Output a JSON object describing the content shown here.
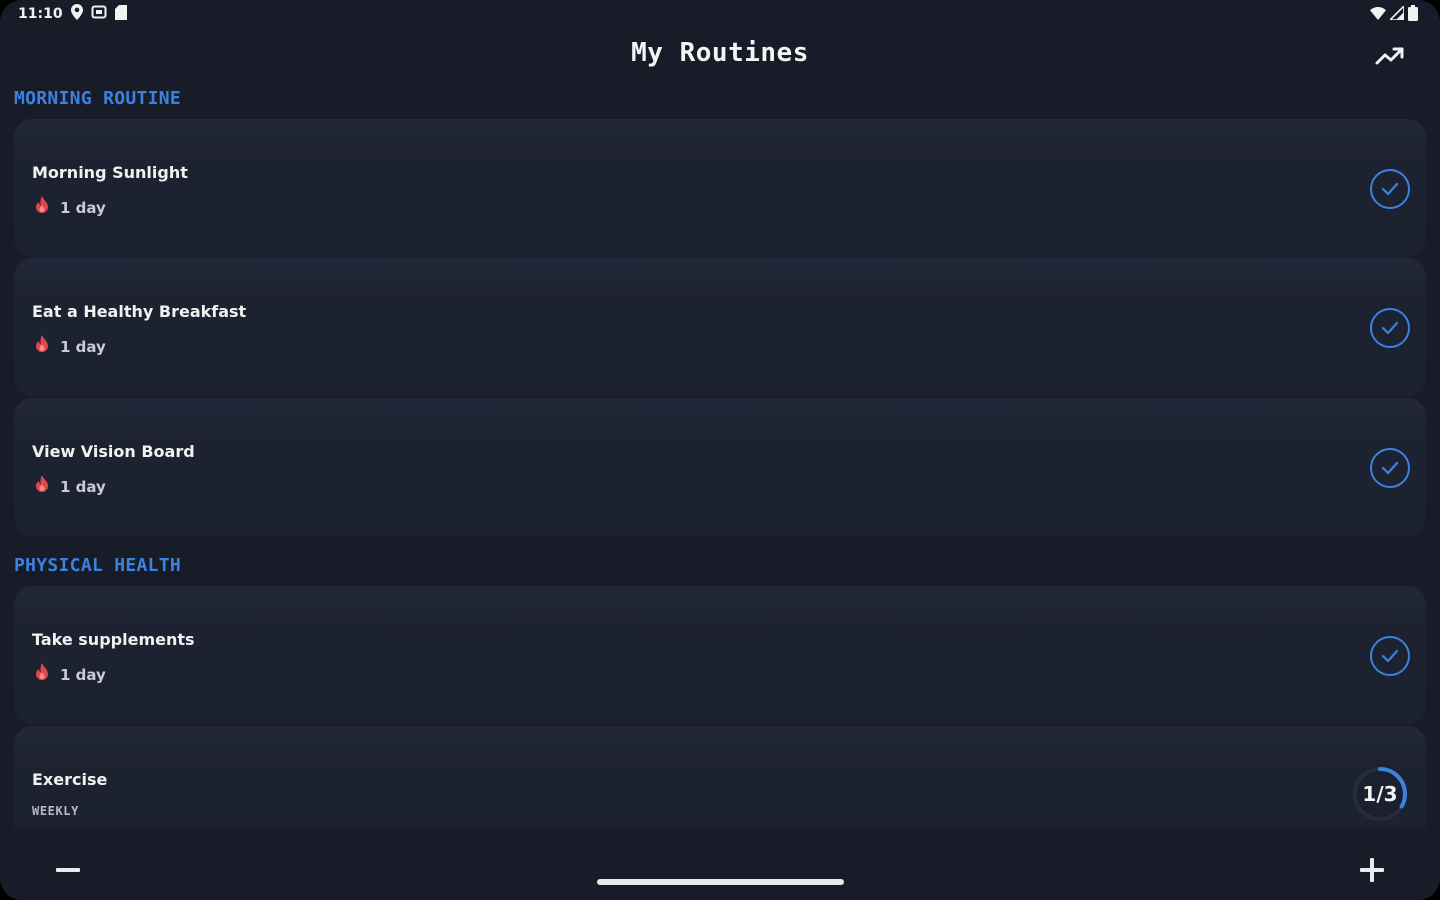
{
  "status_bar": {
    "time": "11:10",
    "left_icons": [
      "location-icon",
      "screen-cast-icon",
      "sd-card-icon"
    ],
    "right_icons": [
      "wifi-icon",
      "signal-icon",
      "battery-icon"
    ]
  },
  "header": {
    "title": "My Routines",
    "trend_icon": "trending-up-icon"
  },
  "sections": [
    {
      "label": "MORNING ROUTINE",
      "items": [
        {
          "name": "Morning Sunlight",
          "streak": "1 day",
          "status": "done"
        },
        {
          "name": "Eat a Healthy Breakfast",
          "streak": "1 day",
          "status": "done"
        },
        {
          "name": "View Vision Board",
          "streak": "1 day",
          "status": "done"
        }
      ]
    },
    {
      "label": "PHYSICAL HEALTH",
      "items": [
        {
          "name": "Take supplements",
          "streak": "1 day",
          "status": "done"
        },
        {
          "name": "Exercise",
          "frequency": "WEEKLY",
          "progress": "1/3",
          "progress_fraction": 0.333
        }
      ]
    }
  ],
  "bottom_bar": {
    "left_icon": "minus-icon",
    "right_icon": "plus-icon"
  },
  "colors": {
    "background": "#181c28",
    "card": "#1d2230",
    "accent": "#3b82e0",
    "flame": "#e0474c"
  }
}
